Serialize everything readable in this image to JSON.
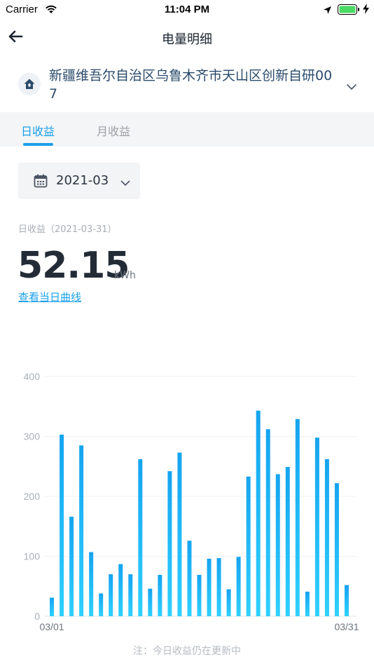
{
  "status_bar": {
    "carrier": "Carrier",
    "time": "11:04 PM"
  },
  "nav": {
    "title": "电量明细"
  },
  "site": {
    "name": "新疆维吾尔自治区乌鲁木齐市天山区创新自研007"
  },
  "tabs": [
    {
      "label": "日收益",
      "active": true
    },
    {
      "label": "月收益",
      "active": false
    }
  ],
  "date_picker": {
    "value": "2021-03"
  },
  "summary": {
    "label": "日收益（2021-03-31）",
    "value": "52.15",
    "unit": "kWh",
    "link": "查看当日曲线"
  },
  "footnote": "注：今日收益仍在更新中",
  "colors": {
    "accent": "#1aa0ea",
    "bar_top": "#16a4f0",
    "bar_bottom": "#2fd0ff"
  },
  "chart_data": {
    "type": "bar",
    "categories": [
      "03/01",
      "03/02",
      "03/03",
      "03/04",
      "03/05",
      "03/06",
      "03/07",
      "03/08",
      "03/09",
      "03/10",
      "03/11",
      "03/12",
      "03/13",
      "03/14",
      "03/15",
      "03/16",
      "03/17",
      "03/18",
      "03/19",
      "03/20",
      "03/21",
      "03/22",
      "03/23",
      "03/24",
      "03/25",
      "03/26",
      "03/27",
      "03/28",
      "03/29",
      "03/30",
      "03/31"
    ],
    "tick_labels": [
      "03/01",
      "03/31"
    ],
    "y_ticks": [
      0,
      100,
      200,
      300,
      400
    ],
    "values": [
      31,
      303,
      166,
      285,
      107,
      38,
      70,
      87,
      70,
      262,
      46,
      69,
      242,
      273,
      126,
      69,
      96,
      97,
      45,
      99,
      233,
      343,
      312,
      237,
      249,
      329,
      41,
      298,
      262,
      222,
      52
    ],
    "ylim": [
      0,
      400
    ],
    "grid": true
  }
}
